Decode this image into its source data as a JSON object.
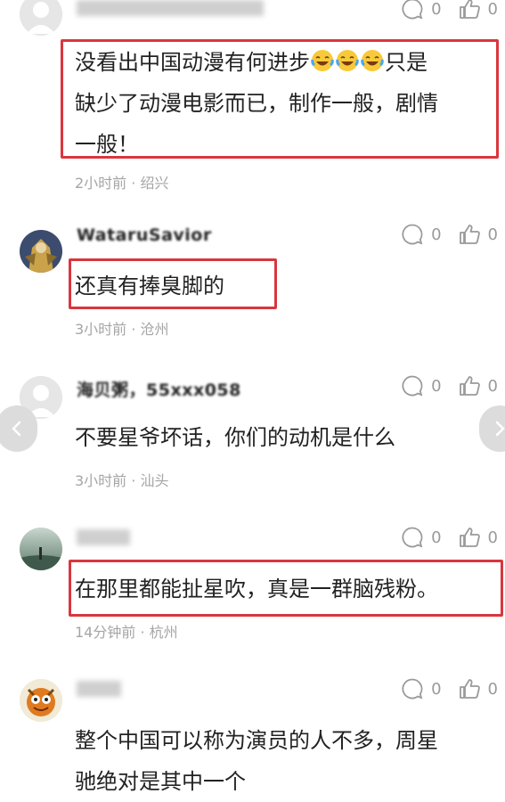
{
  "comments": [
    {
      "username": "",
      "text_lines": [
        "没看出中国动漫有何进步",
        "缺少了动漫电影而已，制作一般，剧情",
        "一般！"
      ],
      "line1_suffix": "只是",
      "emojis": [
        "laughing-crying",
        "laughing-crying",
        "laughing-crying"
      ],
      "meta": "2小时前 · 绍兴",
      "reply_count": "0",
      "like_count": "0"
    },
    {
      "username": "WataruSavior",
      "text_lines": [
        "还真有捧臭脚的"
      ],
      "meta": "3小时前 · 沧州",
      "reply_count": "0",
      "like_count": "0"
    },
    {
      "username": "海贝粥，55xxx058",
      "text_lines": [
        "不要星爷坏话，你们的动机是什么"
      ],
      "meta": "3小时前 · 汕头",
      "reply_count": "0",
      "like_count": "0"
    },
    {
      "username": "",
      "text_lines": [
        "在那里都能扯星吹，真是一群脑残粉。"
      ],
      "meta": "14分钟前 · 杭州",
      "reply_count": "0",
      "like_count": "0"
    },
    {
      "username": "",
      "text_lines": [
        "整个中国可以称为演员的人不多，周星",
        "驰绝对是其中一个"
      ],
      "meta": "",
      "reply_count": "0",
      "like_count": "0"
    }
  ],
  "colors": {
    "highlight": "#d9363e",
    "meta": "#a5a5a5",
    "icon": "#9a9a9a"
  },
  "icons": {
    "reply": "speech-bubble-icon",
    "like": "thumbs-up-icon",
    "prev": "chevron-left-icon",
    "next": "chevron-right-icon"
  }
}
